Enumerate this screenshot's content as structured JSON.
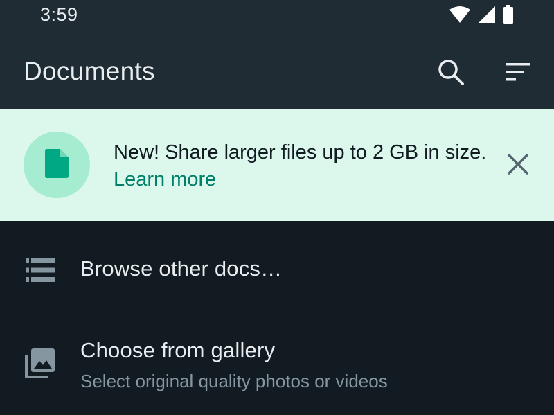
{
  "status_bar": {
    "time": "3:59",
    "icons": [
      "wifi-icon",
      "signal-icon",
      "battery-icon"
    ]
  },
  "app_bar": {
    "title": "Documents",
    "actions": [
      "search-icon",
      "sort-icon"
    ]
  },
  "banner": {
    "icon": "document-icon",
    "text": "New! Share larger files up to 2 GB in size.",
    "link": "Learn more",
    "close_icon": "close-icon"
  },
  "list": {
    "browse": {
      "icon": "list-icon",
      "title": "Browse other docs…"
    },
    "gallery": {
      "icon": "gallery-icon",
      "title": "Choose from gallery",
      "subtitle": "Select original quality photos or videos"
    }
  },
  "colors": {
    "background": "#111b21",
    "bar": "#1f2c34",
    "banner_bg": "#dcf8ec",
    "banner_icon_bg": "#a6ecd0",
    "accent": "#008069",
    "icon_green": "#00a884"
  }
}
